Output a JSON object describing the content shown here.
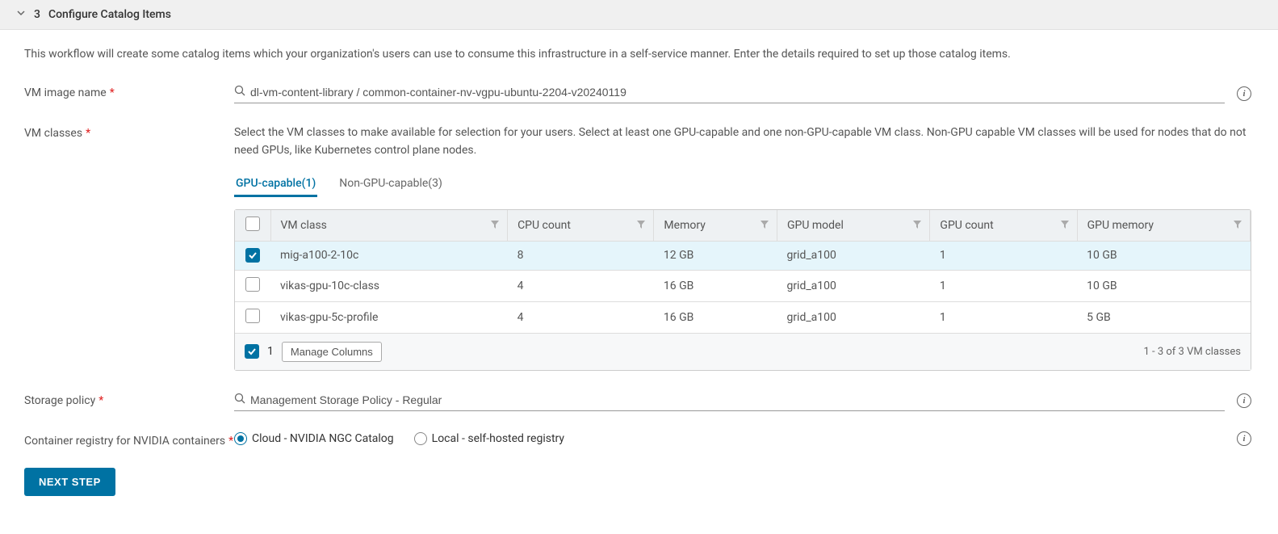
{
  "section": {
    "number": "3",
    "title": "Configure Catalog Items"
  },
  "description": "This workflow will create some catalog items which your organization's users can use to consume this infrastructure in a self-service manner. Enter the details required to set up those catalog items.",
  "vmImage": {
    "label": "VM image name",
    "value": "dl-vm-content-library / common-container-nv-vgpu-ubuntu-2204-v20240119"
  },
  "vmClasses": {
    "label": "VM classes",
    "helper": "Select the VM classes to make available for selection for your users. Select at least one GPU-capable and one non-GPU-capable VM class. Non-GPU capable VM classes will be used for nodes that do not need GPUs, like Kubernetes control plane nodes.",
    "tabs": [
      {
        "label": "GPU-capable(1)",
        "active": true
      },
      {
        "label": "Non-GPU-capable(3)",
        "active": false
      }
    ],
    "columns": [
      "VM class",
      "CPU count",
      "Memory",
      "GPU model",
      "GPU count",
      "GPU memory"
    ],
    "rows": [
      {
        "selected": true,
        "cells": [
          "mig-a100-2-10c",
          "8",
          "12 GB",
          "grid_a100",
          "1",
          "10 GB"
        ]
      },
      {
        "selected": false,
        "cells": [
          "vikas-gpu-10c-class",
          "4",
          "16 GB",
          "grid_a100",
          "1",
          "10 GB"
        ]
      },
      {
        "selected": false,
        "cells": [
          "vikas-gpu-5c-profile",
          "4",
          "16 GB",
          "grid_a100",
          "1",
          "5 GB"
        ]
      }
    ],
    "selectedCount": "1",
    "manageColumns": "Manage Columns",
    "pagination": "1 - 3 of 3 VM classes"
  },
  "storagePolicy": {
    "label": "Storage policy",
    "value": "Management Storage Policy - Regular"
  },
  "containerRegistry": {
    "label": "Container registry for NVIDIA containers",
    "options": [
      {
        "label": "Cloud - NVIDIA NGC Catalog",
        "selected": true
      },
      {
        "label": "Local - self-hosted registry",
        "selected": false
      }
    ]
  },
  "nextStep": "NEXT STEP"
}
